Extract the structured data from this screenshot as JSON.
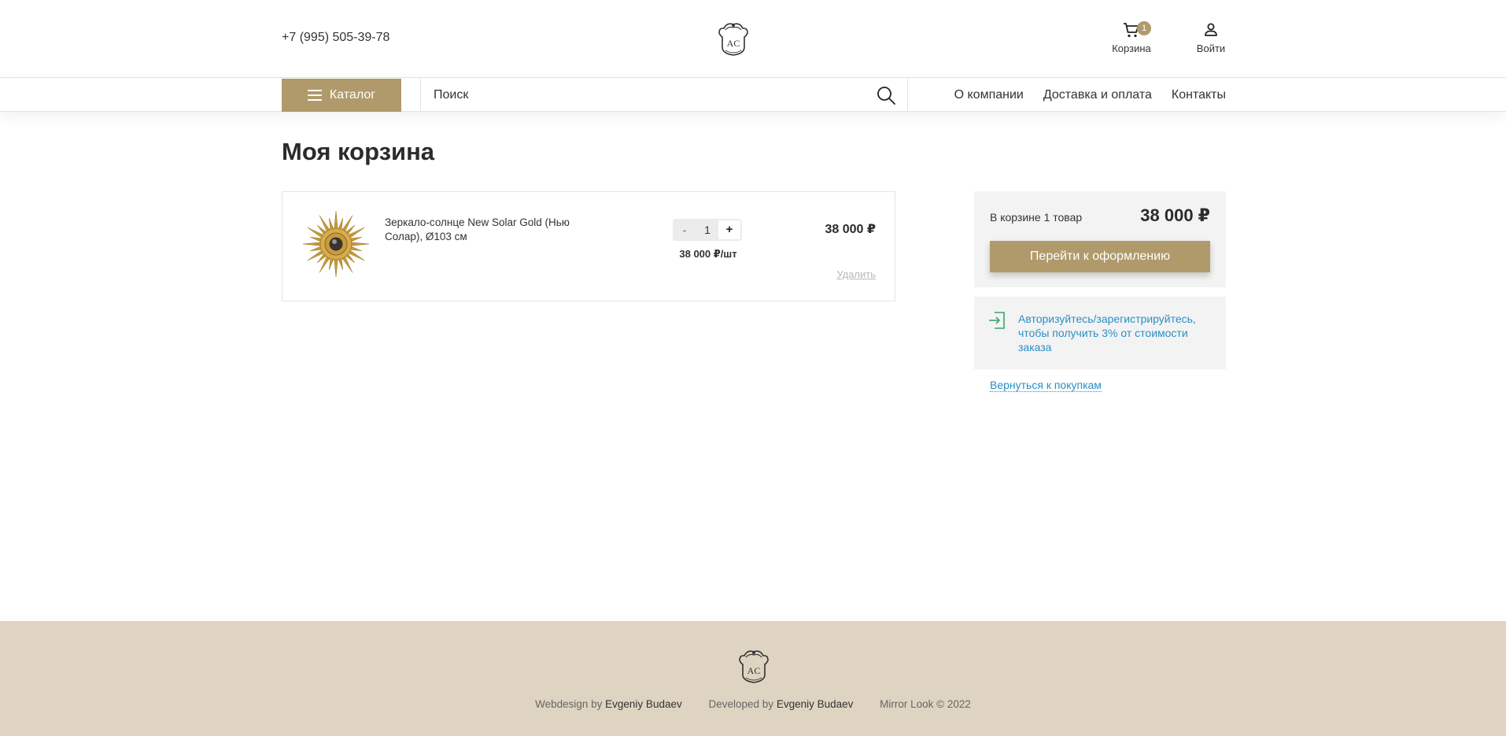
{
  "header": {
    "phone": "+7 (995) 505-39-78",
    "logo": "logo-crest-icon",
    "cart": {
      "label": "Корзина",
      "badge": "1",
      "icon": "cart-icon"
    },
    "login": {
      "label": "Войти",
      "icon": "user-icon"
    }
  },
  "nav": {
    "catalog_label": "Каталог",
    "search_placeholder": "Поиск",
    "links": [
      "О компании",
      "Доставка и оплата",
      "Контакты"
    ]
  },
  "page": {
    "title": "Моя корзина"
  },
  "cart_items": [
    {
      "name": "Зеркало-солнце New Solar Gold (Нью Солар), Ø103 см",
      "quantity": "1",
      "minus": "-",
      "plus": "+",
      "unit_price": "38 000 ₽/шт",
      "total": "38 000 ₽",
      "remove": "Удалить"
    }
  ],
  "summary": {
    "count_text": "В корзине 1 товар",
    "total": "38 000 ₽",
    "checkout_label": "Перейти к оформлению"
  },
  "bonus": {
    "text": "Авторизуйтесь/зарегистрируйтесь, чтобы получить 3% от стоимости заказа"
  },
  "back_link": "Вернуться к покупкам",
  "footer": {
    "webdesign_prefix": "Webdesign by",
    "webdesign_name": "Evgeniy Budaev",
    "developed_prefix": "Developed by",
    "developed_name": "Evgeniy Budaev",
    "copyright": "Mirror Look © 2022"
  },
  "colors": {
    "accent": "#b09a6b",
    "link": "#2a8fc4",
    "footer_bg": "#ded4c1",
    "panel_bg": "#f3f3f3"
  }
}
